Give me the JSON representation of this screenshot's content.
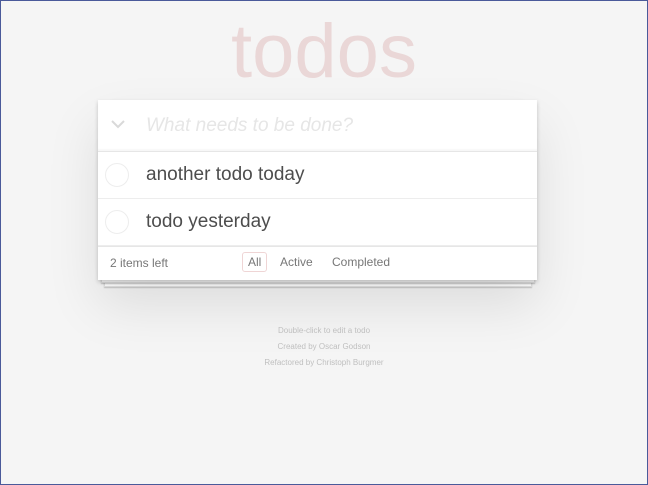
{
  "app": {
    "title": "todos"
  },
  "new_todo": {
    "placeholder": "What needs to be done?",
    "value": ""
  },
  "todos": [
    {
      "label": "another todo today",
      "completed": false
    },
    {
      "label": "todo yesterday",
      "completed": false
    }
  ],
  "footer": {
    "count": "2 items left",
    "filters": [
      {
        "label": "All",
        "selected": true
      },
      {
        "label": "Active",
        "selected": false
      },
      {
        "label": "Completed",
        "selected": false
      }
    ]
  },
  "info": {
    "line1": "Double-click to edit a todo",
    "line2": "Created by Oscar Godson",
    "line3": "Refactored by Christoph Burgmer"
  },
  "colors": {
    "title": "#eadada",
    "background": "#f5f5f5",
    "selected_filter_border": "#efd5d5"
  },
  "icons": {
    "toggle_all": "chevron-down-icon"
  }
}
